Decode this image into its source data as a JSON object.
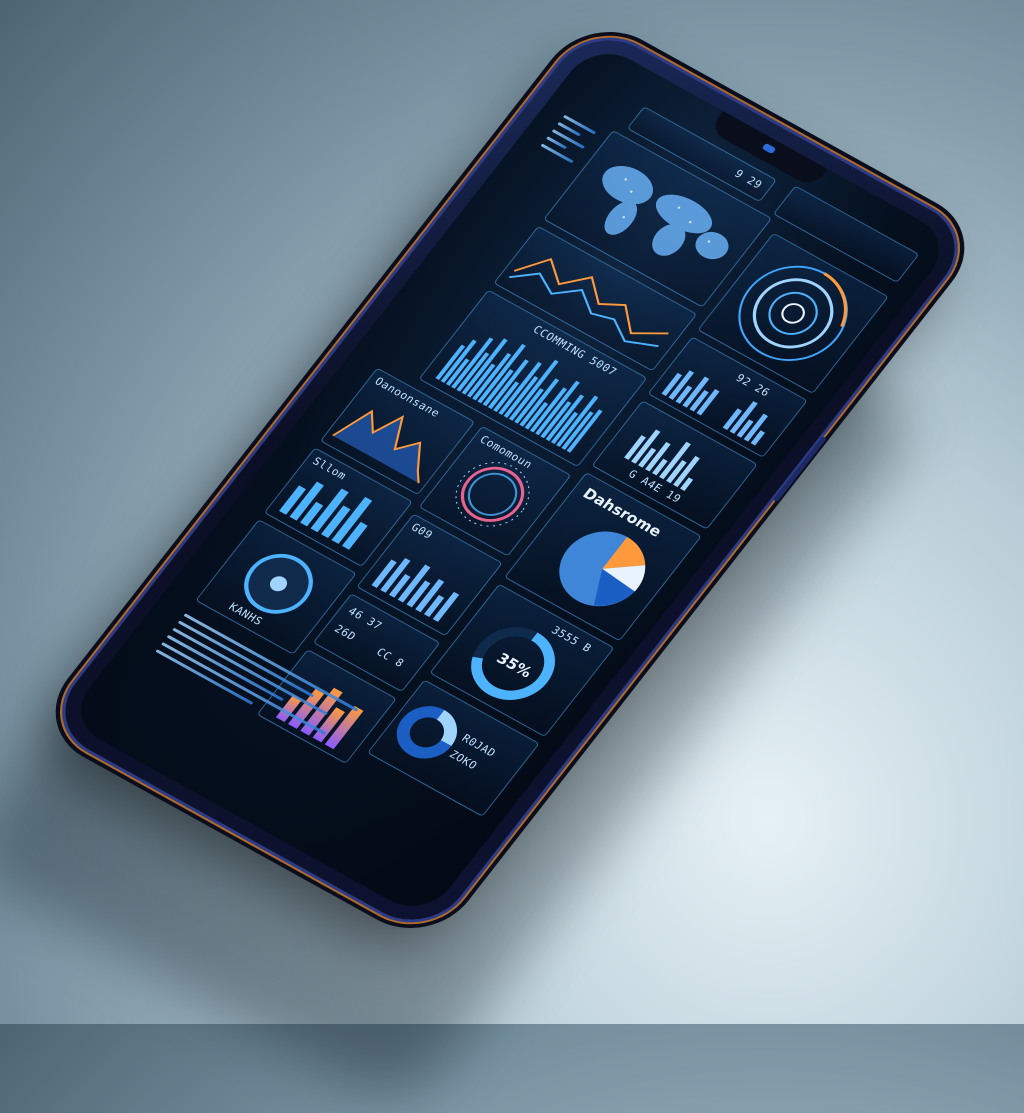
{
  "scene": "smartphone-dashboard",
  "colors": {
    "accent": "#4db3ff",
    "accent_light": "#9fd4ff",
    "accent_dark": "#1c5fc4",
    "orange": "#ff9a3c",
    "screen_bg": "#05101f",
    "frame_edge": "#b06a2a"
  },
  "header": {
    "status_value": "9 29"
  },
  "cards": {
    "stats_title": "Dahsrome",
    "stats_value": "92 26",
    "bar_right_value": "G A4E 19",
    "top_bar_caption": "CCOMMING 5007",
    "donut_label": "35%",
    "donut_caption": "3555 B",
    "mini_stat_1": "R0JAD",
    "mini_stat_2": "ZOKO",
    "mini_stat_3": "46 37",
    "mini_stat_4": "26D",
    "mini_stat_5": "G09",
    "mini_stat_6": "CC 8",
    "mountain_label": "Oanoonsane",
    "bars_label": "Sllom",
    "energy_label": "Comomoun",
    "bottom_label": "KANHS"
  },
  "icons": [
    "globe-map-icon",
    "radar-icon",
    "pie-icon",
    "donut-icon",
    "particle-ring-icon",
    "gauge-icon"
  ]
}
